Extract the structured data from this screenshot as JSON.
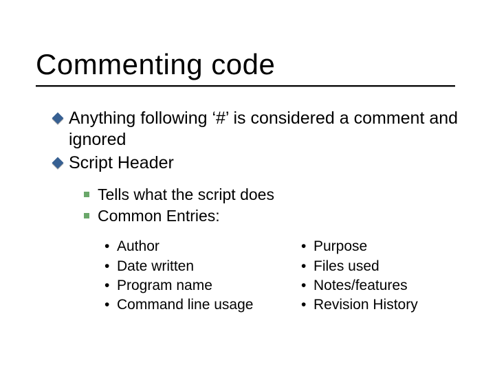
{
  "title": "Commenting code",
  "points": [
    "Anything following ‘#’ is considered a comment and ignored",
    "Script Header"
  ],
  "sub": [
    "Tells what the script does",
    "Common Entries:"
  ],
  "entries_left": [
    "Author",
    "Date written",
    "Program name",
    "Command line usage"
  ],
  "entries_right": [
    "Purpose",
    "Files used",
    "Notes/features",
    "Revision History"
  ]
}
